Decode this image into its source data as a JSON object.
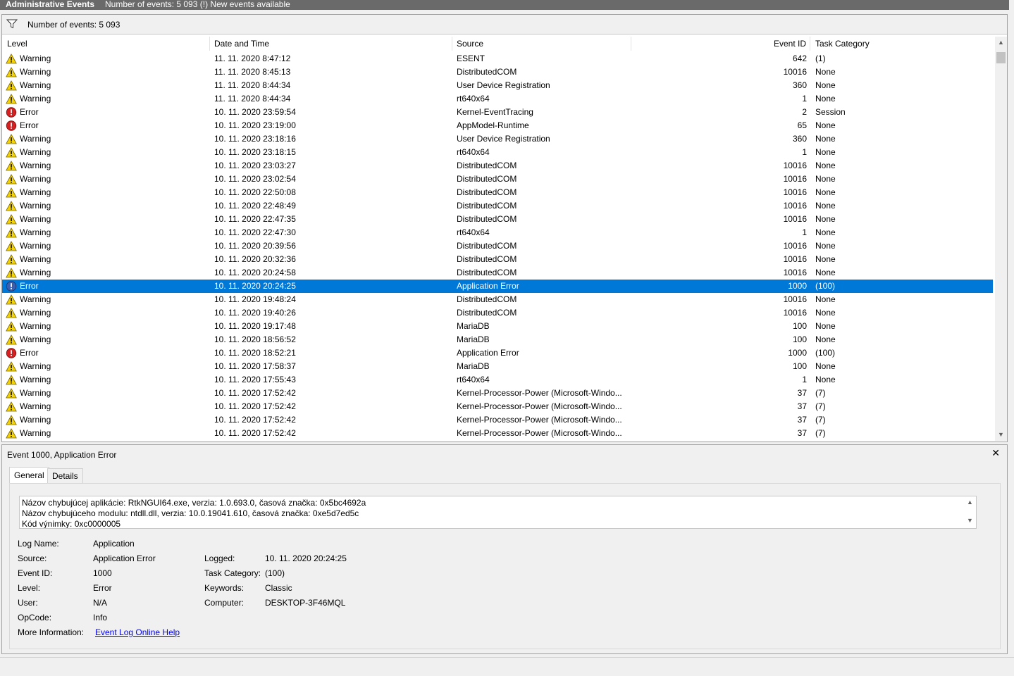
{
  "window": {
    "title": "Administrative Events",
    "subtitle": "Number of events: 5 093 (!) New events available"
  },
  "filter": {
    "icon": "filter-icon",
    "text": "Number of events: 5 093"
  },
  "columns": [
    "Level",
    "Date and Time",
    "Source",
    "Event ID",
    "Task Category"
  ],
  "rows": [
    {
      "level": "Warning",
      "date": "11. 11. 2020 8:47:12",
      "source": "ESENT",
      "event_id": "642",
      "category": "(1)"
    },
    {
      "level": "Warning",
      "date": "11. 11. 2020 8:45:13",
      "source": "DistributedCOM",
      "event_id": "10016",
      "category": "None"
    },
    {
      "level": "Warning",
      "date": "11. 11. 2020 8:44:34",
      "source": "User Device Registration",
      "event_id": "360",
      "category": "None"
    },
    {
      "level": "Warning",
      "date": "11. 11. 2020 8:44:34",
      "source": "rt640x64",
      "event_id": "1",
      "category": "None"
    },
    {
      "level": "Error",
      "date": "10. 11. 2020 23:59:54",
      "source": "Kernel-EventTracing",
      "event_id": "2",
      "category": "Session"
    },
    {
      "level": "Error",
      "date": "10. 11. 2020 23:19:00",
      "source": "AppModel-Runtime",
      "event_id": "65",
      "category": "None"
    },
    {
      "level": "Warning",
      "date": "10. 11. 2020 23:18:16",
      "source": "User Device Registration",
      "event_id": "360",
      "category": "None"
    },
    {
      "level": "Warning",
      "date": "10. 11. 2020 23:18:15",
      "source": "rt640x64",
      "event_id": "1",
      "category": "None"
    },
    {
      "level": "Warning",
      "date": "10. 11. 2020 23:03:27",
      "source": "DistributedCOM",
      "event_id": "10016",
      "category": "None"
    },
    {
      "level": "Warning",
      "date": "10. 11. 2020 23:02:54",
      "source": "DistributedCOM",
      "event_id": "10016",
      "category": "None"
    },
    {
      "level": "Warning",
      "date": "10. 11. 2020 22:50:08",
      "source": "DistributedCOM",
      "event_id": "10016",
      "category": "None"
    },
    {
      "level": "Warning",
      "date": "10. 11. 2020 22:48:49",
      "source": "DistributedCOM",
      "event_id": "10016",
      "category": "None"
    },
    {
      "level": "Warning",
      "date": "10. 11. 2020 22:47:35",
      "source": "DistributedCOM",
      "event_id": "10016",
      "category": "None"
    },
    {
      "level": "Warning",
      "date": "10. 11. 2020 22:47:30",
      "source": "rt640x64",
      "event_id": "1",
      "category": "None"
    },
    {
      "level": "Warning",
      "date": "10. 11. 2020 20:39:56",
      "source": "DistributedCOM",
      "event_id": "10016",
      "category": "None"
    },
    {
      "level": "Warning",
      "date": "10. 11. 2020 20:32:36",
      "source": "DistributedCOM",
      "event_id": "10016",
      "category": "None"
    },
    {
      "level": "Warning",
      "date": "10. 11. 2020 20:24:58",
      "source": "DistributedCOM",
      "event_id": "10016",
      "category": "None"
    },
    {
      "level": "Error",
      "date": "10. 11. 2020 20:24:25",
      "source": "Application Error",
      "event_id": "1000",
      "category": "(100)",
      "selected": true
    },
    {
      "level": "Warning",
      "date": "10. 11. 2020 19:48:24",
      "source": "DistributedCOM",
      "event_id": "10016",
      "category": "None"
    },
    {
      "level": "Warning",
      "date": "10. 11. 2020 19:40:26",
      "source": "DistributedCOM",
      "event_id": "10016",
      "category": "None"
    },
    {
      "level": "Warning",
      "date": "10. 11. 2020 19:17:48",
      "source": "MariaDB",
      "event_id": "100",
      "category": "None"
    },
    {
      "level": "Warning",
      "date": "10. 11. 2020 18:56:52",
      "source": "MariaDB",
      "event_id": "100",
      "category": "None"
    },
    {
      "level": "Error",
      "date": "10. 11. 2020 18:52:21",
      "source": "Application Error",
      "event_id": "1000",
      "category": "(100)"
    },
    {
      "level": "Warning",
      "date": "10. 11. 2020 17:58:37",
      "source": "MariaDB",
      "event_id": "100",
      "category": "None"
    },
    {
      "level": "Warning",
      "date": "10. 11. 2020 17:55:43",
      "source": "rt640x64",
      "event_id": "1",
      "category": "None"
    },
    {
      "level": "Warning",
      "date": "10. 11. 2020 17:52:42",
      "source": "Kernel-Processor-Power (Microsoft-Windo...",
      "event_id": "37",
      "category": "(7)"
    },
    {
      "level": "Warning",
      "date": "10. 11. 2020 17:52:42",
      "source": "Kernel-Processor-Power (Microsoft-Windo...",
      "event_id": "37",
      "category": "(7)"
    },
    {
      "level": "Warning",
      "date": "10. 11. 2020 17:52:42",
      "source": "Kernel-Processor-Power (Microsoft-Windo...",
      "event_id": "37",
      "category": "(7)"
    },
    {
      "level": "Warning",
      "date": "10. 11. 2020 17:52:42",
      "source": "Kernel-Processor-Power (Microsoft-Windo...",
      "event_id": "37",
      "category": "(7)"
    }
  ],
  "detail": {
    "title": "Event 1000, Application Error",
    "close": "✕",
    "tabs": [
      "General",
      "Details"
    ],
    "description": [
      "Názov chybujúcej aplikácie: RtkNGUI64.exe, verzia: 1.0.693.0, časová značka: 0x5bc4692a",
      "Názov chybujúceho modulu: ntdll.dll, verzia: 10.0.19041.610, časová značka: 0xe5d7ed5c",
      "Kód výnimky: 0xc0000005"
    ],
    "fields": {
      "log_name_label": "Log Name:",
      "log_name": "Application",
      "source_label": "Source:",
      "source": "Application Error",
      "logged_label": "Logged:",
      "logged": "10. 11. 2020 20:24:25",
      "event_id_label": "Event ID:",
      "event_id": "1000",
      "task_category_label": "Task Category:",
      "task_category": "(100)",
      "level_label": "Level:",
      "level": "Error",
      "keywords_label": "Keywords:",
      "keywords": "Classic",
      "user_label": "User:",
      "user": "N/A",
      "computer_label": "Computer:",
      "computer": "DESKTOP-3F46MQL",
      "opcode_label": "OpCode:",
      "opcode": "Info",
      "more_info_label": "More Information:",
      "more_info_link": "Event Log Online Help"
    }
  },
  "colors": {
    "selection": "#0078d7",
    "titlebar": "#6a6a6a",
    "warning": "#f5d300",
    "error": "#d42020",
    "link": "#0000ee"
  }
}
